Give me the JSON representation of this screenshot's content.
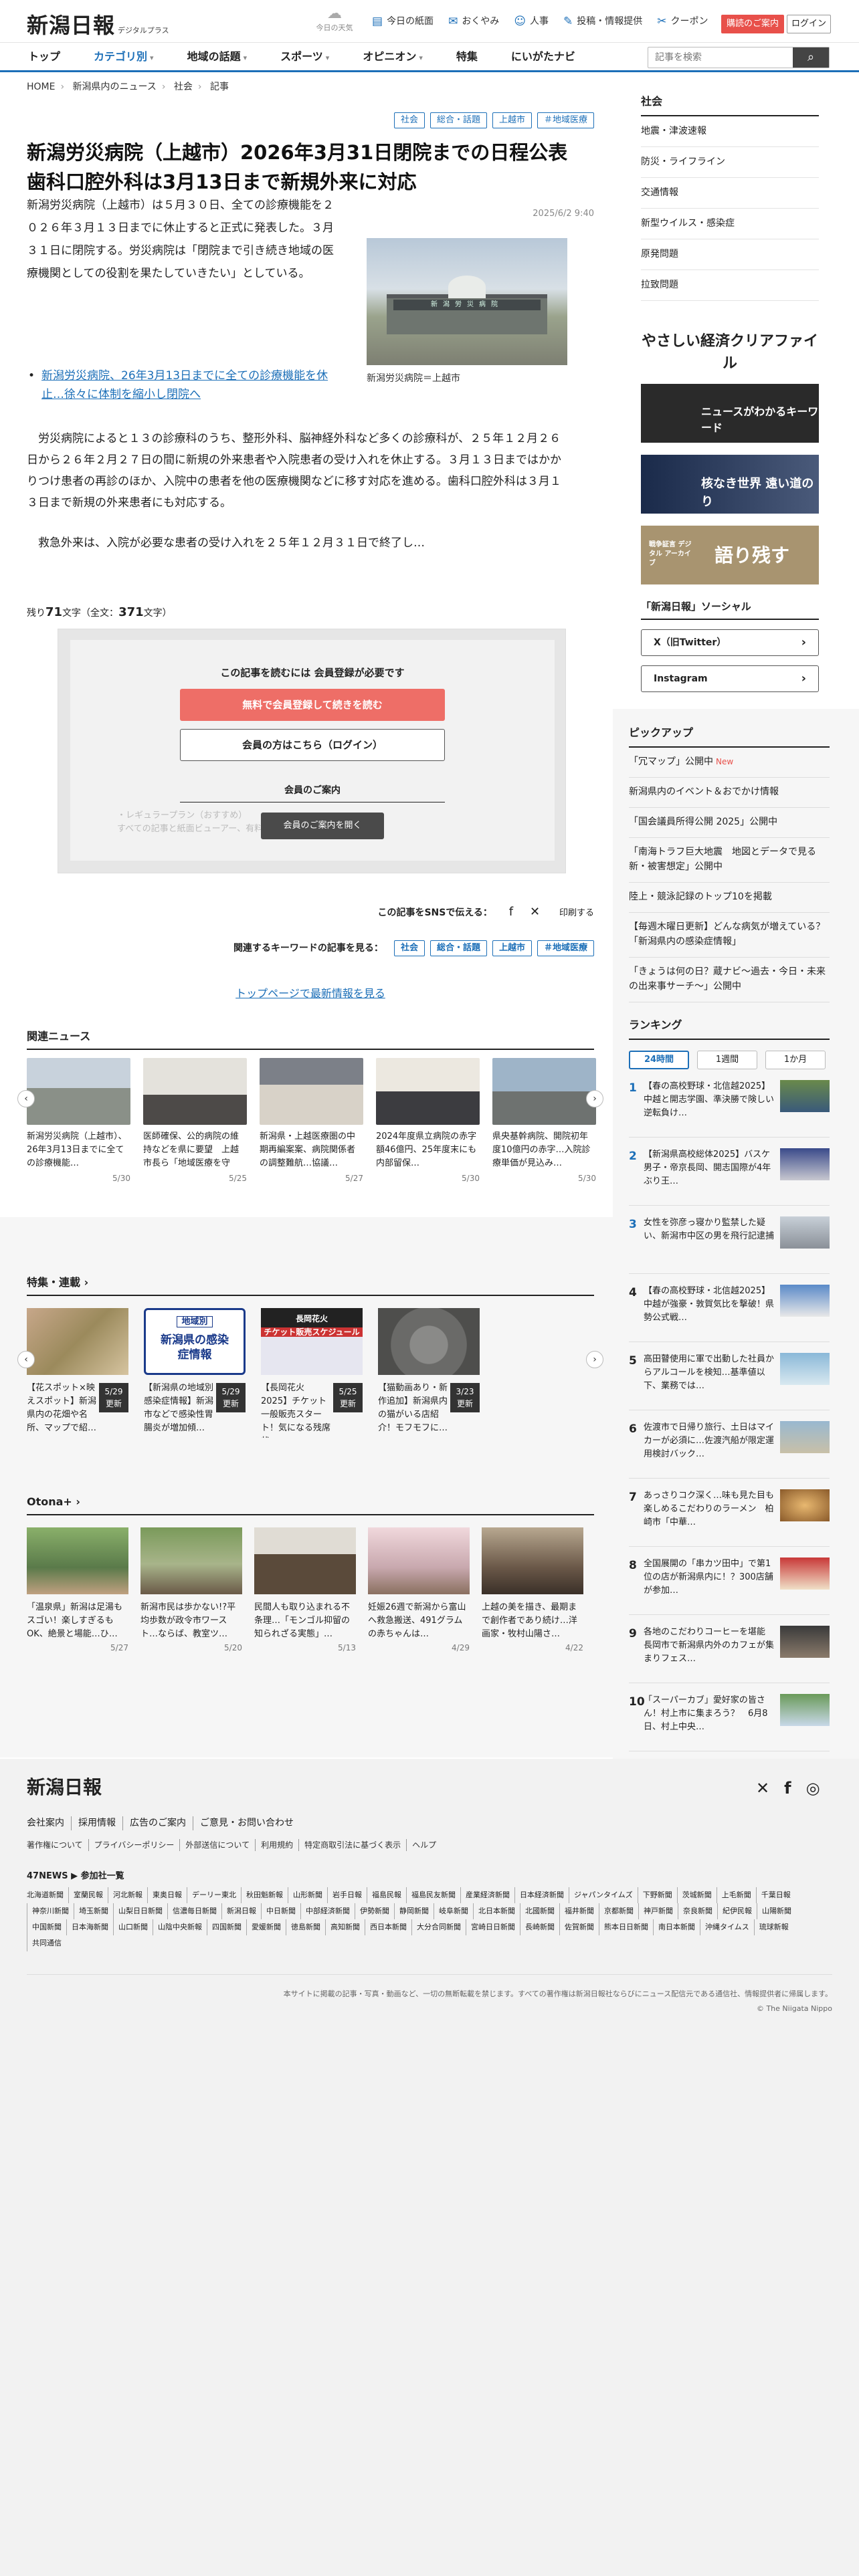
{
  "header": {
    "logo": "新潟日報",
    "logo_sub": "デジタルプラス",
    "weather": "今日の天気",
    "utils": [
      {
        "icon": "newspaper-icon",
        "label": "今日の紙面"
      },
      {
        "icon": "obituary-icon",
        "label": "おくやみ"
      },
      {
        "icon": "people-icon",
        "label": "人事"
      },
      {
        "icon": "chat-icon",
        "label": "投稿・情報提供"
      },
      {
        "icon": "coupon-icon",
        "label": "クーポン"
      }
    ],
    "ad_button": "購読のご案内",
    "login_button": "ログイン"
  },
  "nav": {
    "items": [
      "トップ",
      "カテゴリ別",
      "地域の話題",
      "スポーツ",
      "オピニオン",
      "特集",
      "にいがたナビ"
    ],
    "search_placeholder": "記事を検索"
  },
  "breadcrumb": [
    "HOME",
    "新潟県内のニュース",
    "社会",
    "記事"
  ],
  "article": {
    "tags": [
      "社会",
      "総合・話題",
      "上越市",
      "＃地域医療"
    ],
    "title": "新潟労災病院（上越市）2026年3月31日閉院までの日程公表　歯科口腔外科は3月13日まで新規外来に対応",
    "date": "2025/6/2 9:40",
    "lead": "新潟労災病院（上越市）は５月３０日、全ての診療機能を２０２６年３月１３日までに休止すると正式に発表した。３月３１日に閉院する。労災病院は「閉院まで引き続き地域の医療機関としての役割を果たしていきたい」としている。",
    "photo_caption": "新潟労災病院＝上越市",
    "photo_sign": "新潟労災病院",
    "related_link": "新潟労災病院、26年3月13日までに全ての診療機能を休止…徐々に体制を縮小し閉院へ",
    "para1": "労災病院によると１３の診療科のうち、整形外科、脳神経外科など多くの診療科が、２５年１２月２６日から２６年２月２７日の間に新規の外来患者や入院患者の受け入れを休止する。３月１３日まではかかりつけ患者の再診のほか、入院中の患者を他の医療機関などに移す対応を進める。歯科口腔外科は３月１３日まで新規の外来患者にも対応する。",
    "para2": "救急外来は、入院が必要な患者の受け入れを２５年１２月３１日で終了し…",
    "remain_prefix": "残り",
    "remain_count": "71",
    "remain_mid": "文字（全文：",
    "total_count": "371",
    "remain_suffix": "文字）"
  },
  "paywall": {
    "heading": "この記事を読むには 会員登録が必要です",
    "register": "無料で会員登録して続きを読む",
    "login": "会員の方はこちら（ログイン）",
    "guide_title": "会員のご案内",
    "guide_fade1": "・レギュラープラン（おすすめ）",
    "guide_fade2": "すべての記事と紙面ビューアー、有料記事をご覧いただけます。",
    "guide_button": "会員のご案内を開く"
  },
  "share": {
    "label": "この記事をSNSで伝える：",
    "print": "印刷する"
  },
  "keywords": {
    "label": "関連するキーワードの記事を見る：",
    "tags": [
      "社会",
      "総合・話題",
      "上越市",
      "＃地域医療"
    ]
  },
  "toplink": "トップページで最新情報を見る",
  "related": {
    "title": "関連ニュース",
    "items": [
      {
        "t": "新潟労災病院（上越市）、26年3月13日までに全ての診療機能…",
        "d": "5/30"
      },
      {
        "t": "医師確保、公的病院の維持などを県に要望　上越市長ら「地域医療を守る…",
        "d": "5/25"
      },
      {
        "t": "新潟県・上越医療圏の中期再編案案、病院関係者の調整難航…協議…",
        "d": "5/27"
      },
      {
        "t": "2024年度県立病院の赤字額46億円、25年度末にも内部留保…",
        "d": "5/30"
      },
      {
        "t": "県央基幹病院、開院初年度10億円の赤字…入院診療単価が見込み…",
        "d": "5/30"
      }
    ]
  },
  "features": {
    "title": "特集・連載",
    "items": [
      {
        "t": "【花スポット×映えスポット】新潟県内の花畑や名所、マップで紹…",
        "u": "5/29"
      },
      {
        "t": "【新潟県の地域別感染症情報】新潟市などで感染性胃腸炎が増加傾…",
        "u": "5/29"
      },
      {
        "t": "【長岡花火2025】チケット一般販売スタート！気になる残席状…",
        "u": "5/25"
      },
      {
        "t": "【猫動画あり・新作追加】新潟県内の猫がいる店紹介！モフモフに…",
        "u": "3/23"
      }
    ],
    "update": "更新",
    "card_label": "地域別",
    "card_title": "新潟県の感染症情報",
    "fw_title": "長岡花火",
    "fw_sub": "チケット販売スケジュール"
  },
  "otona": {
    "title": "Otona+",
    "items": [
      {
        "t": "「温泉県」新潟は足湯もスゴい！楽しすぎるもOK、絶景と場能…ひ…",
        "d": "5/27"
      },
      {
        "t": "新潟市民は歩かない!?平均歩数が政令市ワースト…ならば、教室ツ…",
        "d": "5/20"
      },
      {
        "t": "民間人も取り込まれる不条理…「モンゴル抑留の知られざる実態」…",
        "d": "5/13"
      },
      {
        "t": "妊娠26週で新潟から富山へ救急搬送、491グラムの赤ちゃんは…",
        "d": "4/29"
      },
      {
        "t": "上越の美を描き、最期まで創作者であり続け…洋画家・牧村山陽さ…",
        "d": "4/22"
      }
    ]
  },
  "sidebar": {
    "category": "社会",
    "list": [
      "地震・津波速報",
      "防災・ライフライン",
      "交通情報",
      "新型ウイルス・感染症",
      "原発問題",
      "拉致問題"
    ],
    "banners": [
      "やさしい経済クリアファイル",
      "ニュースがわかるキーワード",
      "核なき世界 遠い道のり",
      "語り残す"
    ],
    "banner_side": "戦争証言 デジタル アーカイブ",
    "social_title": "「新潟日報」ソーシャル",
    "social": [
      "X（旧Twitter）",
      "Instagram"
    ]
  },
  "pickup": {
    "title": "ピックアップ",
    "items": [
      {
        "t": "「冗マップ」公開中",
        "new": "New"
      },
      {
        "t": "新潟県内のイベント＆おでかけ情報"
      },
      {
        "t": "「国会議員所得公開 2025」公開中"
      },
      {
        "t": "「南海トラフ巨大地震　地図とデータで見る新・被害想定」公開中"
      },
      {
        "t": "陸上・競泳記録のトップ10を掲載"
      },
      {
        "t": "【毎週木曜日更新】どんな病気が増えている？「新潟県内の感染症情報」"
      },
      {
        "t": "「きょうは何の日？蔵ナビ～過去・今日・未来の出来事サーチ～」公開中"
      }
    ]
  },
  "ranking": {
    "title": "ランキング",
    "tabs": [
      "24時間",
      "1週間",
      "1か月"
    ],
    "items": [
      {
        "n": "1",
        "t": "【春の高校野球・北信越2025】中越と開志学園、準決勝で険しい逆転負け…"
      },
      {
        "n": "2",
        "t": "【新潟県高校総体2025】バスケ男子・帝京長岡、開志国際が4年ぶり王…"
      },
      {
        "n": "3",
        "t": "女性を弥彦っ寝かり監禁した疑い、新潟市中区の男を飛行記逮捕"
      },
      {
        "n": "4",
        "t": "【春の高校野球・北信越2025】中越が強豪・敦賀気比を撃破！県勢公式戦…"
      },
      {
        "n": "5",
        "t": "高田瞽使用に軍で出動した社員からアルコールを検知…基準値以下、業務では…"
      },
      {
        "n": "6",
        "t": "佐渡市で日帰り旅行、土日はマイカーが必須に…佐渡汽船が限定運用検討バック…"
      },
      {
        "n": "7",
        "t": "あっさりコク深く…味も見た目も楽しめるこだわりのラーメン　柏崎市「中華…"
      },
      {
        "n": "8",
        "t": "全国展開の「串カツ田中」で第1位の店が新潟県内に！？300店舗が参加…"
      },
      {
        "n": "9",
        "t": "各地のこだわりコーヒーを堪能　長岡市で新潟県内外のカフェが集まりフェス…"
      },
      {
        "n": "10",
        "t": "「スーパーカブ」愛好家の皆さん！村上市に集まろう？　6月8日、村上中央…"
      }
    ]
  },
  "footer": {
    "logo": "新潟日報",
    "links": [
      "会社案内",
      "採用情報",
      "広告のご案内",
      "ご意見・お問い合わせ"
    ],
    "links2": [
      "著作権について",
      "プライバシーポリシー",
      "外部送信について",
      "利用規約",
      "特定商取引法に基づく表示",
      "ヘルプ"
    ],
    "n47_title": "47NEWS ▶ 参加社一覧",
    "n47": [
      "北海道新聞",
      "室蘭民報",
      "河北新報",
      "東奥日報",
      "デーリー東北",
      "秋田魁新報",
      "山形新聞",
      "岩手日報",
      "福島民報",
      "福島民友新聞",
      "産業経済新聞",
      "日本経済新聞",
      "ジャパンタイムズ",
      "下野新聞",
      "茨城新聞",
      "上毛新聞",
      "千葉日報",
      "神奈川新聞",
      "埼玉新聞",
      "山梨日日新聞",
      "信濃毎日新聞",
      "新潟日報",
      "中日新聞",
      "中部経済新聞",
      "伊勢新聞",
      "静岡新聞",
      "岐阜新聞",
      "北日本新聞",
      "北國新聞",
      "福井新聞",
      "京都新聞",
      "神戸新聞",
      "奈良新聞",
      "紀伊民報",
      "山陽新聞",
      "中国新聞",
      "日本海新聞",
      "山口新聞",
      "山陰中央新報",
      "四国新聞",
      "愛媛新聞",
      "徳島新聞",
      "高知新聞",
      "西日本新聞",
      "大分合同新聞",
      "宮崎日日新聞",
      "長崎新聞",
      "佐賀新聞",
      "熊本日日新聞",
      "南日本新聞",
      "沖縄タイムス",
      "琉球新報",
      "共同通信"
    ],
    "notice": "本サイトに掲載の記事・写真・動画など、一切の無断転載を禁じます。すべての著作権は新潟日報社ならびにニュース配信元である通信社、情報提供者に帰属します。",
    "copyright": "© The Niigata Nippo"
  }
}
